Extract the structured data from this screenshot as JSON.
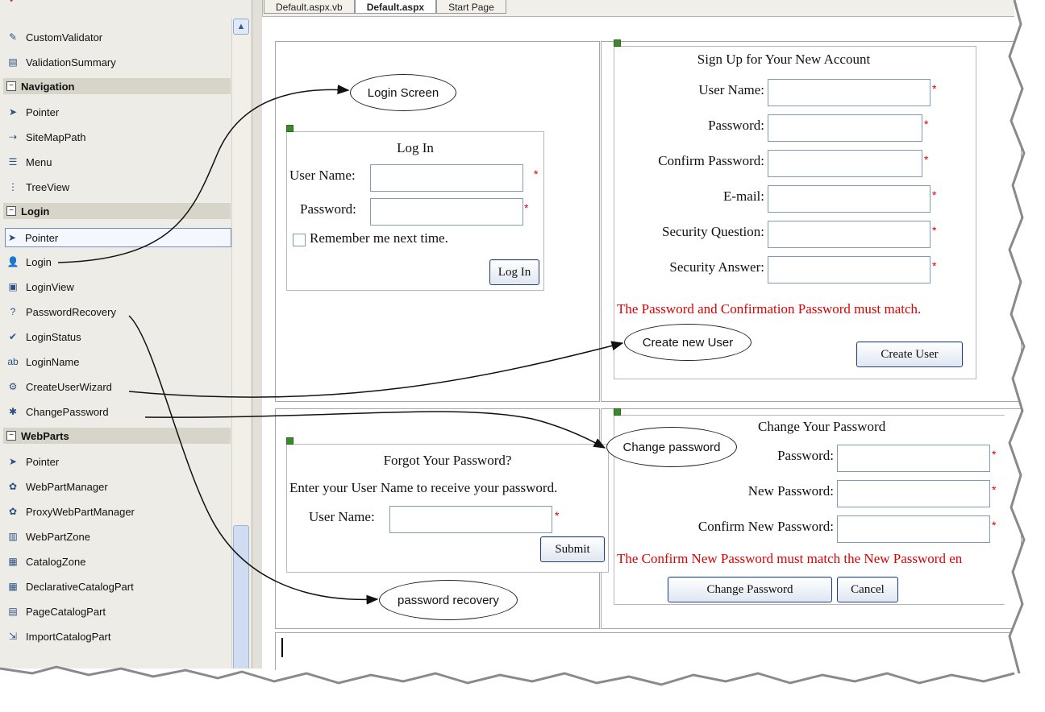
{
  "toolbox": {
    "items_top": [
      {
        "label": "CustomValidator",
        "icon": "custom-validator-icon"
      },
      {
        "label": "ValidationSummary",
        "icon": "validation-summary-icon"
      }
    ],
    "groups": [
      {
        "title": "Navigation",
        "items": [
          {
            "label": "Pointer",
            "icon": "pointer-icon"
          },
          {
            "label": "SiteMapPath",
            "icon": "sitemappath-icon"
          },
          {
            "label": "Menu",
            "icon": "menu-icon"
          },
          {
            "label": "TreeView",
            "icon": "treeview-icon"
          }
        ]
      },
      {
        "title": "Login",
        "items": [
          {
            "label": "Pointer",
            "icon": "pointer-icon"
          },
          {
            "label": "Login",
            "icon": "login-icon"
          },
          {
            "label": "LoginView",
            "icon": "loginview-icon"
          },
          {
            "label": "PasswordRecovery",
            "icon": "password-recovery-icon"
          },
          {
            "label": "LoginStatus",
            "icon": "loginstatus-icon"
          },
          {
            "label": "LoginName",
            "icon": "loginname-icon"
          },
          {
            "label": "CreateUserWizard",
            "icon": "createuserwizard-icon"
          },
          {
            "label": "ChangePassword",
            "icon": "changepassword-icon"
          }
        ]
      },
      {
        "title": "WebParts",
        "items": [
          {
            "label": "Pointer",
            "icon": "pointer-icon"
          },
          {
            "label": "WebPartManager",
            "icon": "webpartmanager-icon"
          },
          {
            "label": "ProxyWebPartManager",
            "icon": "proxywebpartmanager-icon"
          },
          {
            "label": "WebPartZone",
            "icon": "webpartzone-icon"
          },
          {
            "label": "CatalogZone",
            "icon": "catalogzone-icon"
          },
          {
            "label": "DeclarativeCatalogPart",
            "icon": "declarativecatalogpart-icon"
          },
          {
            "label": "PageCatalogPart",
            "icon": "pagecatalogpart-icon"
          },
          {
            "label": "ImportCatalogPart",
            "icon": "importcatalogpart-icon"
          }
        ]
      }
    ]
  },
  "tabs": [
    {
      "label": "Default.aspx.vb",
      "active": false
    },
    {
      "label": "Default.aspx",
      "active": true
    },
    {
      "label": "Start Page",
      "active": false
    }
  ],
  "login": {
    "title": "Log In",
    "username_label": "User Name:",
    "password_label": "Password:",
    "remember_label": "Remember me next time.",
    "button": "Log In",
    "required": "*"
  },
  "signup": {
    "title": "Sign Up for Your New Account",
    "fields": [
      {
        "label": "User Name:"
      },
      {
        "label": "Password:"
      },
      {
        "label": "Confirm Password:"
      },
      {
        "label": "E-mail:"
      },
      {
        "label": "Security Question:"
      },
      {
        "label": "Security Answer:"
      }
    ],
    "error": "The Password and Confirmation Password must match.",
    "button": "Create User"
  },
  "recovery": {
    "title": "Forgot Your Password?",
    "instructions": "Enter your User Name to receive your password.",
    "username_label": "User Name:",
    "button": "Submit"
  },
  "change": {
    "title": "Change Your Password",
    "fields": [
      {
        "label": "Password:"
      },
      {
        "label": "New Password:"
      },
      {
        "label": "Confirm New Password:"
      }
    ],
    "error": "The Confirm New Password must match the New Password en",
    "change_button": "Change Password",
    "cancel_button": "Cancel"
  },
  "callouts": {
    "login_screen": "Login Screen",
    "create_new_user": "Create new User",
    "change_password": "Change password",
    "password_recovery": "password recovery"
  },
  "colors": {
    "error": "#e00000",
    "toolbox_bg": "#eeece6",
    "group_header": "#d7d4ca"
  }
}
